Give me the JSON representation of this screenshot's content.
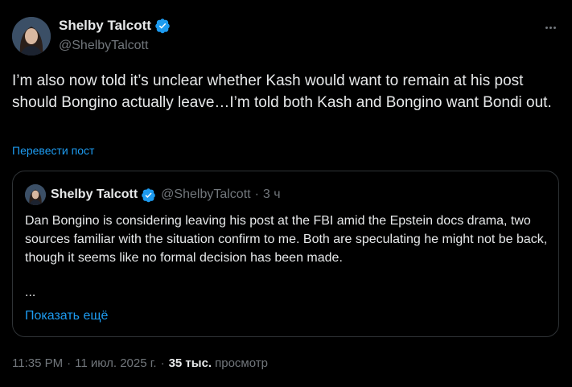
{
  "tweet": {
    "author_name": "Shelby Talcott",
    "author_handle": "@ShelbyTalcott",
    "text": "I’m also now told it’s unclear whether Kash would want to remain at his post should Bongino actually leave…I’m told both Kash and Bongino want Bondi out.",
    "translate_label": "Перевести пост",
    "more_icon": "ellipsis-icon",
    "verified_icon": "verified-badge-icon"
  },
  "quote": {
    "author_name": "Shelby Talcott",
    "author_handle": "@ShelbyTalcott",
    "separator": "·",
    "time": "3 ч",
    "text": "Dan Bongino is considering leaving his post at the FBI amid the Epstein docs drama, two sources familiar with the situation confirm to me. Both are speculating he might not be back, though it seems like no formal decision has been made.",
    "ellipsis": "...",
    "show_more_label": "Показать ещё"
  },
  "meta": {
    "time": "11:35 PM",
    "separator": "·",
    "date": "11 июл. 2025 г.",
    "views_count": "35 тыс.",
    "views_label": "просмотр"
  },
  "colors": {
    "background": "#000000",
    "text": "#e7e9ea",
    "muted": "#71767b",
    "accent": "#1d9bf0",
    "border": "#2f3336"
  }
}
